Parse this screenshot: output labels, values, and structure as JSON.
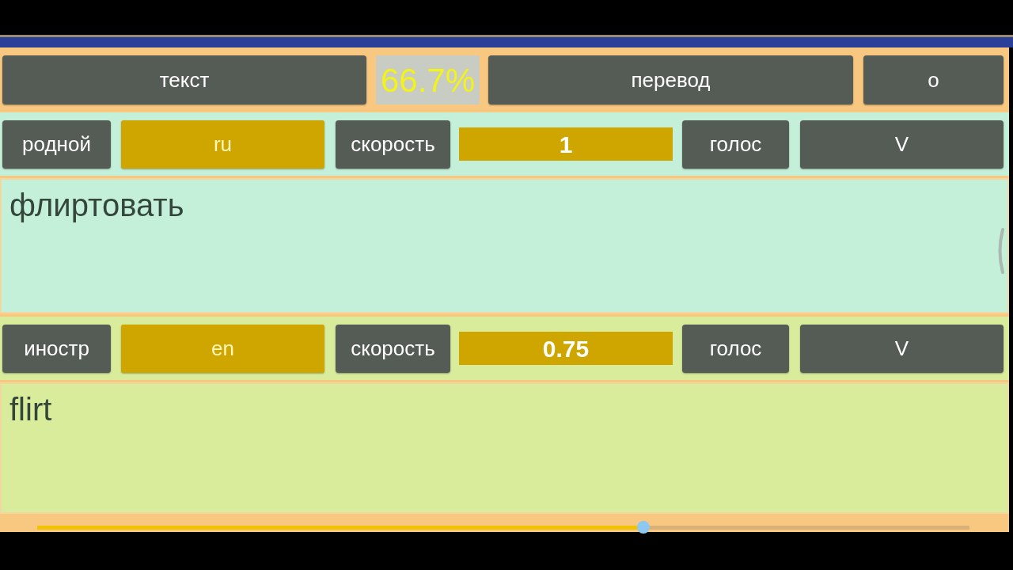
{
  "toolbar": {
    "text_button": "текст",
    "progress_percent": "66.7%",
    "translate_button": "перевод",
    "about_button": "о"
  },
  "panels": [
    {
      "kind": "native",
      "role": "родной",
      "language": "ru",
      "speed_label": "скорость",
      "speed": "1",
      "voice_label": "голос",
      "voice": "V",
      "text": {
        "value": "флиртовать"
      }
    },
    {
      "kind": "foreign",
      "role": "иностр",
      "language": "en",
      "speed_label": "скорость",
      "speed": "0.75",
      "voice_label": "голос",
      "voice": "V",
      "text": {
        "value": "flirt"
      }
    }
  ],
  "progress": {
    "level": 0.65
  }
}
